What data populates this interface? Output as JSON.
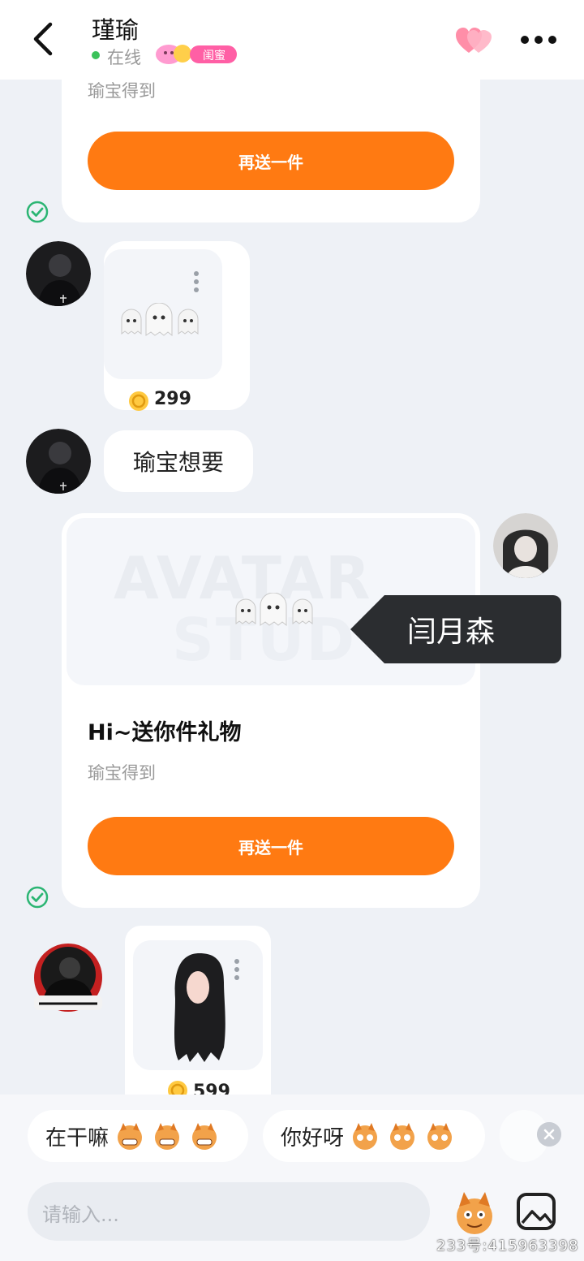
{
  "header": {
    "title": "瑾瑜",
    "status": "在线",
    "badge_label": "闺蜜"
  },
  "messages": {
    "top_card_subtitle": "瑜宝得到",
    "top_card_button": "再送一件",
    "gift1_price": "299",
    "text_message": "瑜宝想要",
    "gift_card_title": "Hi~送你件礼物",
    "gift_card_subtitle": "瑜宝得到",
    "gift_card_button": "再送一件",
    "gift2_price": "599",
    "tooltip_name": "闫月森",
    "faded_watermark_1": "AVATAR",
    "faded_watermark_2": "STUD"
  },
  "quick_replies": [
    {
      "label": "在干嘛"
    },
    {
      "label": "你好呀"
    }
  ],
  "composer": {
    "placeholder": "请输入..."
  },
  "watermark": "233号:415963398",
  "colors": {
    "accent": "#ff7a12",
    "online": "#3bc25a",
    "check": "#2bb573",
    "background": "#eef1f6"
  },
  "icons": [
    "back-icon",
    "heart-icon",
    "more-icon",
    "check-icon",
    "ghost-icon",
    "coin-icon",
    "close-icon",
    "emoji-icon",
    "gallery-icon"
  ]
}
